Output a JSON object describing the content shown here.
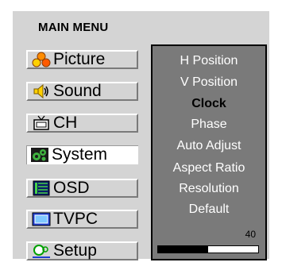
{
  "main_menu": {
    "title": "MAIN MENU",
    "items": [
      {
        "label": "Picture",
        "icon": "palette-icon"
      },
      {
        "label": "Sound",
        "icon": "speaker-icon"
      },
      {
        "label": "CH",
        "icon": "tv-icon"
      },
      {
        "label": "System",
        "icon": "gears-icon"
      },
      {
        "label": "OSD",
        "icon": "osd-icon"
      },
      {
        "label": "TVPC",
        "icon": "monitor-icon"
      },
      {
        "label": "Setup",
        "icon": "setup-icon"
      }
    ],
    "selected_index": 3
  },
  "submenu": {
    "items": [
      "H Position",
      "V Position",
      "Clock",
      "Phase",
      "Auto Adjust",
      "Aspect Ratio",
      "Resolution",
      "Default"
    ],
    "active_index": 2,
    "value": "40",
    "progress_fraction": 0.5
  },
  "colors": {
    "menu_bg": "#d4d4d4",
    "panel_bg": "#7a7a7a",
    "submenu_text": "#ffffff",
    "active_text": "#000000",
    "selected_item_bg": "#ffffff"
  }
}
